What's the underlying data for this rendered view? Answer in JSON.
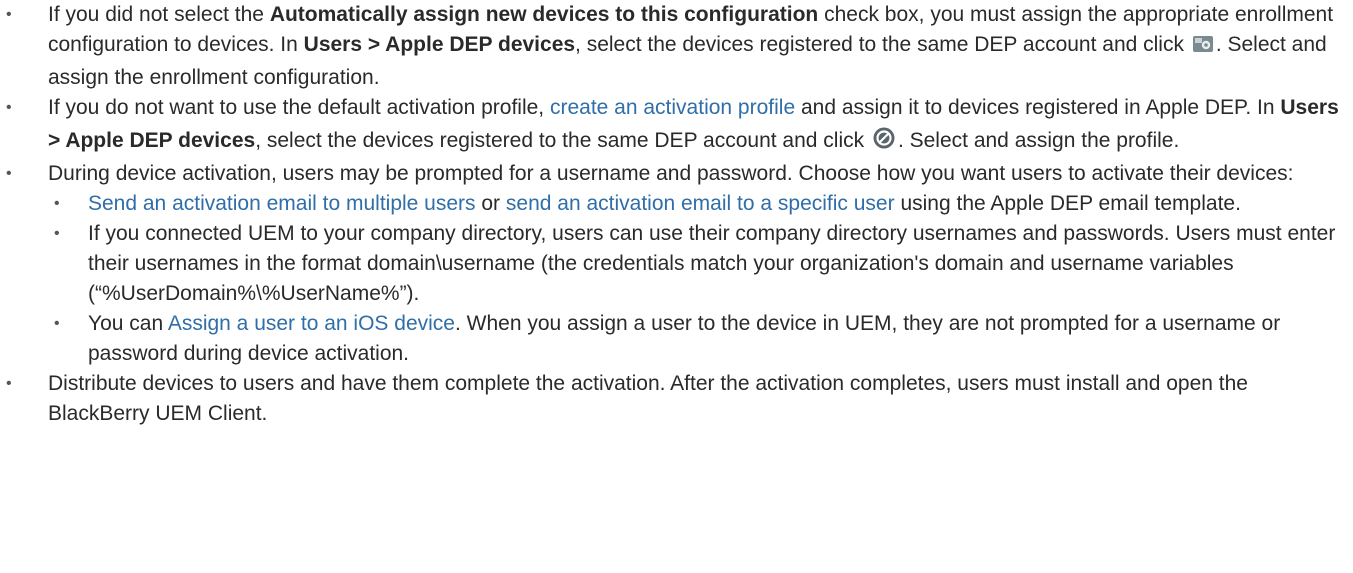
{
  "bullets": [
    {
      "text_a": "If you did not select the ",
      "bold_a": "Automatically assign new devices to this configuration",
      "text_b": " check box, you must assign the appropriate enrollment configuration to devices. In ",
      "bold_b": "Users > Apple DEP devices",
      "text_c": ", select the devices registered to the same DEP account and click ",
      "icon": "enrollment-config-icon",
      "text_d": ". Select and assign the enrollment configuration."
    },
    {
      "text_a": "If you do not want to use the default activation profile, ",
      "link_a": "create an activation profile",
      "text_b": "  and assign it to devices registered in Apple DEP. In ",
      "bold_a": "Users > Apple DEP devices",
      "text_c": ", select the devices registered to the same DEP account and click ",
      "icon": "activation-profile-icon",
      "text_d": ". Select and assign the profile."
    },
    {
      "text_a": "During device activation, users may be prompted for a username and password. Choose how you want users to activate their devices:",
      "sub": [
        {
          "link_a": "Send an activation email to multiple users",
          "text_a": " or ",
          "link_b": "send an activation email to a specific user",
          "text_b": " using the Apple DEP email template."
        },
        {
          "text_a": "If you connected UEM to your company directory, users can use their company directory usernames and passwords. Users must enter their usernames in the format domain\\username (the credentials match your organization's domain and username variables (“%UserDomain%\\%UserName%”)."
        },
        {
          "text_a": "You can ",
          "link_a": "Assign a user to an iOS device",
          "text_b": ". When you assign a user to the device in UEM, they are not prompted for a username or password during device activation."
        }
      ]
    },
    {
      "text_a": "Distribute devices to users and have them complete the activation. After the activation completes, users must install and open the BlackBerry UEM Client."
    }
  ],
  "bullet_glyph": "•",
  "colors": {
    "text": "#2a2a2a",
    "link": "#2f6ea8"
  }
}
